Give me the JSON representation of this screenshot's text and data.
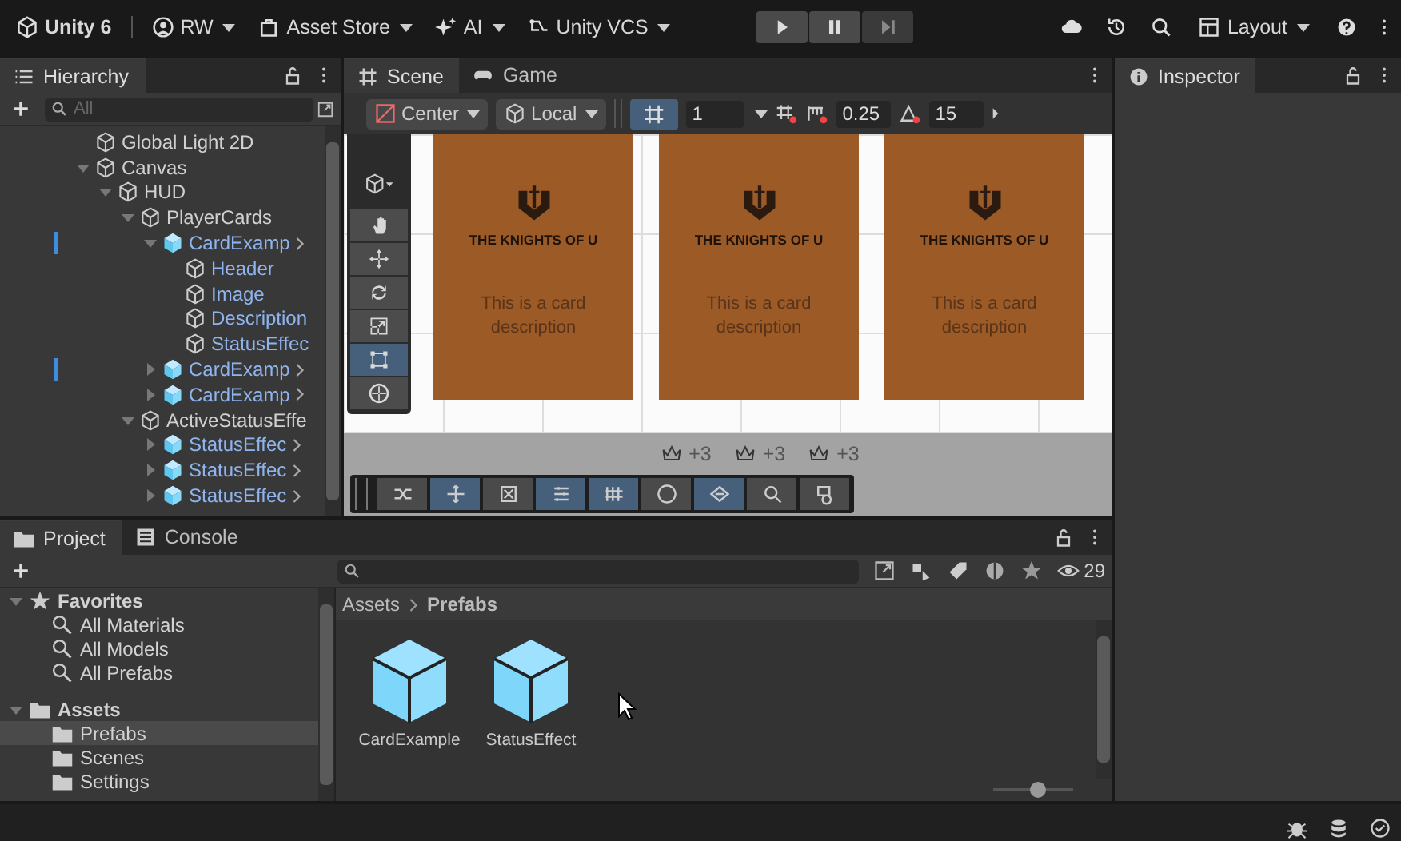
{
  "toolbar": {
    "title": "Unity 6",
    "menus": [
      {
        "label": "RW",
        "kind": "account"
      },
      {
        "label": "Asset Store",
        "kind": "store"
      },
      {
        "label": "AI",
        "kind": "ai"
      },
      {
        "label": "Unity VCS",
        "kind": "vcs"
      }
    ],
    "layout": "Layout"
  },
  "hierarchy": {
    "tab": "Hierarchy",
    "search_placeholder": "All",
    "items": [
      {
        "label": "Global Light 2D",
        "kind": "object"
      },
      {
        "label": "Canvas",
        "kind": "object",
        "expanded": true,
        "children": [
          {
            "label": "HUD",
            "kind": "object",
            "expanded": true,
            "children": [
              {
                "label": "PlayerCards",
                "kind": "object",
                "expanded": true,
                "children": [
                  {
                    "label": "CardExamp",
                    "kind": "prefab",
                    "expanded": true,
                    "overridden": true,
                    "children": [
                      {
                        "label": "Header",
                        "kind": "object"
                      },
                      {
                        "label": "Image",
                        "kind": "object"
                      },
                      {
                        "label": "Description",
                        "kind": "object"
                      },
                      {
                        "label": "StatusEffec",
                        "kind": "object"
                      }
                    ]
                  },
                  {
                    "label": "CardExamp",
                    "kind": "prefab",
                    "expanded": false,
                    "overridden": true
                  },
                  {
                    "label": "CardExamp",
                    "kind": "prefab",
                    "expanded": false,
                    "overridden": false
                  }
                ]
              },
              {
                "label": "ActiveStatusEffe",
                "kind": "object",
                "expanded": true,
                "children": [
                  {
                    "label": "StatusEffec",
                    "kind": "prefab",
                    "expanded": false
                  },
                  {
                    "label": "StatusEffec",
                    "kind": "prefab",
                    "expanded": false
                  },
                  {
                    "label": "StatusEffec",
                    "kind": "prefab",
                    "expanded": false
                  }
                ]
              }
            ]
          }
        ]
      }
    ]
  },
  "scene": {
    "tabs": [
      {
        "label": "Scene",
        "kind": "scene",
        "selected": true
      },
      {
        "label": "Game",
        "kind": "game",
        "selected": false
      }
    ],
    "pivot": "Center",
    "space": "Local",
    "grid_value": "1",
    "snap_value": "0.25",
    "angle_value": "15",
    "tools": [
      {
        "kind": "hand",
        "selected": false
      },
      {
        "kind": "move",
        "selected": false
      },
      {
        "kind": "rotate",
        "selected": false
      },
      {
        "kind": "scale",
        "selected": false
      },
      {
        "kind": "rect",
        "selected": true
      },
      {
        "kind": "transform",
        "selected": false
      }
    ],
    "cards": [
      {
        "brand": "THE KNIGHTS OF U",
        "description": "This is a card description"
      },
      {
        "brand": "THE KNIGHTS OF U",
        "description": "This is a card description"
      },
      {
        "brand": "THE KNIGHTS OF U",
        "description": "This is a card description"
      }
    ],
    "badges": [
      "+3",
      "+3",
      "+3"
    ],
    "overlay_tools": [
      {
        "selected": false
      },
      {
        "selected": true
      },
      {
        "selected": false
      },
      {
        "selected": true
      },
      {
        "selected": true
      },
      {
        "selected": false
      },
      {
        "selected": true
      },
      {
        "selected": false
      },
      {
        "selected": false
      }
    ]
  },
  "inspector": {
    "tab": "Inspector"
  },
  "project": {
    "tabs": [
      {
        "label": "Project",
        "kind": "project",
        "selected": true
      },
      {
        "label": "Console",
        "kind": "console",
        "selected": false
      }
    ],
    "count": "29",
    "favorites": {
      "label": "Favorites",
      "items": [
        "All Materials",
        "All Models",
        "All Prefabs"
      ]
    },
    "assets": {
      "label": "Assets",
      "items": [
        {
          "label": "Prefabs",
          "selected": true
        },
        {
          "label": "Scenes",
          "selected": false
        },
        {
          "label": "Settings",
          "selected": false
        }
      ]
    },
    "breadcrumb": [
      "Assets",
      "Prefabs"
    ],
    "files": [
      {
        "name": "CardExample"
      },
      {
        "name": "StatusEffect"
      }
    ],
    "zoom": {
      "level": 0.55
    }
  }
}
